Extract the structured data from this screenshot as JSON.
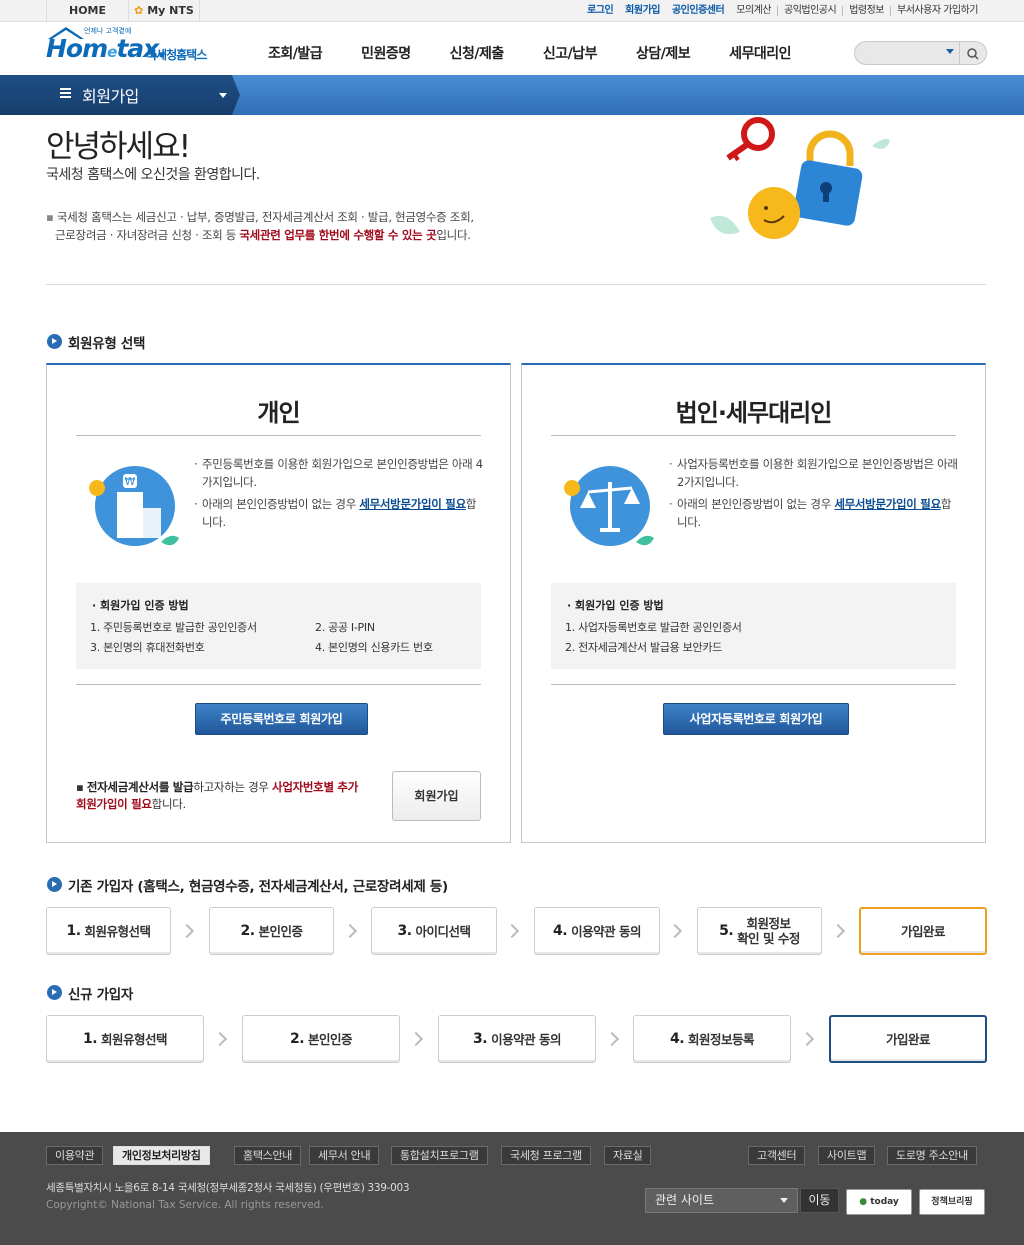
{
  "topbar": {
    "home": "HOME",
    "mynts": "My NTS",
    "links": [
      "로그인",
      "회원가입",
      "공인인증센터",
      "모의계산",
      "공익법인공시",
      "법령정보",
      "부서사용자 가입하기"
    ]
  },
  "header": {
    "logo_small": "언제나 고객곁에",
    "logo_main": "Hom",
    "logo_tax": "tax.",
    "logo_e": "e",
    "logo_sub": "국세청홈택스",
    "nav": [
      "조회/발급",
      "민원증명",
      "신청/제출",
      "신고/납부",
      "상담/제보",
      "세무대리인"
    ]
  },
  "band": {
    "title": "회원가입"
  },
  "greeting": {
    "hello": "안녕하세요!",
    "welcome": "국세청 홈택스에 오신것을 환영합니다.",
    "intro_1": "국세청 홈택스는 세금신고 · 납부, 증명발급, 전자세금계산서 조회 · 발급, 현금영수증 조회,",
    "intro_2a": "근로장려금 · 자녀장려금 신청 · 조회 등 ",
    "intro_2b": "국세관련 업무를 한번에 수행할 수 있는 곳",
    "intro_2c": "입니다."
  },
  "section_type": {
    "title": "회원유형 선택"
  },
  "personal": {
    "title": "개인",
    "desc1": "주민등록번호를 이용한 회원가입으로 본인인증방법은 아래 4가지입니다.",
    "desc2a": "아래의 본인인증방법이 없는 경우 ",
    "desc2b": "세무서방문가입이 필요",
    "desc2c": "합니다.",
    "method_title": "회원가입 인증 방법",
    "methods": [
      "1. 주민등록번호로 발급한 공인인증서",
      "2. 공공 I-PIN",
      "3. 본인명의 휴대전화번호",
      "4. 본인명의 신용카드 번호"
    ],
    "button": "주민등록번호로 회원가입",
    "note_a": "전자세금계산서를 발급",
    "note_b": "하고자하는 경우 ",
    "note_c": "사업자번호별 추가 회원가입이 필요",
    "note_d": "합니다.",
    "join_button": "회원가입"
  },
  "corporate": {
    "title": "법인·세무대리인",
    "desc1": "사업자등록번호를 이용한 회원가입으로 본인인증방법은 아래 2가지입니다.",
    "desc2a": "아래의 본인인증방법이 없는 경우 ",
    "desc2b": "세무서방문가입이 필요",
    "desc2c": "합니다.",
    "method_title": "회원가입 인증 방법",
    "methods": [
      "1. 사업자등록번호로 발급한 공인인증서",
      "2. 전자세금계산서 발급용 보안카드"
    ],
    "button": "사업자등록번호로 회원가입"
  },
  "existing": {
    "title": "기존 가입자 (홈택스, 현금영수증, 전자세금계산서, 근로장려세제 등)",
    "steps": [
      {
        "num": "1.",
        "label": "회원유형선택"
      },
      {
        "num": "2.",
        "label": "본인인증"
      },
      {
        "num": "3.",
        "label": "아이디선택"
      },
      {
        "num": "4.",
        "label": "이용약관 동의"
      },
      {
        "num": "5.",
        "label": "회원정보",
        "label2": "확인 및 수정"
      },
      {
        "num": "",
        "label": "가입완료"
      }
    ]
  },
  "newuser": {
    "title": "신규 가입자",
    "steps": [
      {
        "num": "1.",
        "label": "회원유형선택"
      },
      {
        "num": "2.",
        "label": "본인인증"
      },
      {
        "num": "3.",
        "label": "이용약관 동의"
      },
      {
        "num": "4.",
        "label": "회원정보등록"
      },
      {
        "num": "",
        "label": "가입완료"
      }
    ]
  },
  "footer": {
    "links_left": [
      "이용약관",
      "개인정보처리방침",
      "홈택스안내",
      "세무서 안내",
      "통합설치프로그램",
      "국세청 프로그램",
      "자료실"
    ],
    "links_right": [
      "고객센터",
      "사이트맵",
      "도로명 주소안내"
    ],
    "address": "세종특별자치시 노을6로 8-14 국세청(정부세종2청사 국세청동) (우편번호) 339-003",
    "copyright": "Copyright© National Tax Service. All rights reserved.",
    "related": "관련 사이트",
    "go": "이동",
    "badge1": "today",
    "badge2": "정책브리핑"
  },
  "colors": {
    "accent": "#2a6db5",
    "brand": "#0b6bb8",
    "emphasis": "#a10c1c",
    "complete_orange": "#f0a020"
  }
}
